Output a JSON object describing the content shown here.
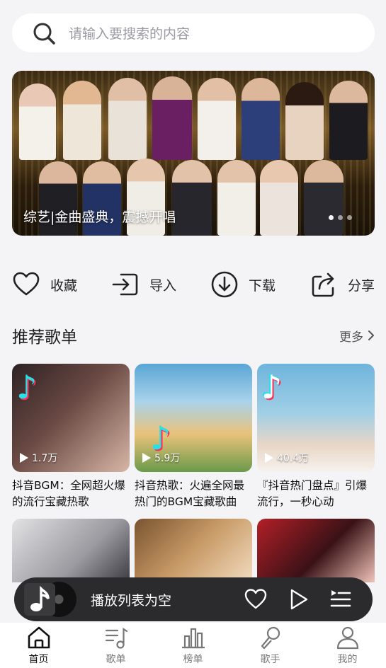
{
  "search": {
    "placeholder": "请输入要搜索的内容",
    "icon": "search-icon"
  },
  "banner": {
    "caption": "综艺|金曲盛典，震撼开唱",
    "dots": 3,
    "active_dot": 0
  },
  "actions": [
    {
      "label": "收藏",
      "icon": "heart-icon"
    },
    {
      "label": "导入",
      "icon": "import-icon"
    },
    {
      "label": "下载",
      "icon": "download-icon"
    },
    {
      "label": "分享",
      "icon": "share-icon"
    }
  ],
  "section": {
    "title": "推荐歌单",
    "more": "更多"
  },
  "playlists": [
    {
      "plays": "1.7万",
      "title": "抖音BGM：全网超火爆的流行宝藏热歌",
      "color_a": "#3b2b2e",
      "color_b": "#c9a79a"
    },
    {
      "plays": "5.9万",
      "title": "抖音热歌：火遍全网最热门的BGM宝藏歌曲",
      "color_a": "#5aa6d6",
      "color_b": "#e9c27a"
    },
    {
      "plays": "40.4万",
      "title": "『抖音热门盘点』引爆流行，一秒心动",
      "color_a": "#6fb4dc",
      "color_b": "#e8d6c6"
    }
  ],
  "more_covers": [
    {
      "color_a": "#cfcfd2",
      "color_b": "#6a6a70"
    },
    {
      "color_a": "#b98858",
      "color_b": "#f3dcc0"
    },
    {
      "color_a": "#b31f27",
      "color_b": "#f0c4b8"
    }
  ],
  "player": {
    "title": "播放列表为空"
  },
  "tabs": [
    {
      "label": "首页",
      "icon": "home-icon",
      "active": true
    },
    {
      "label": "歌单",
      "icon": "playlist-icon",
      "active": false
    },
    {
      "label": "榜单",
      "icon": "chart-icon",
      "active": false
    },
    {
      "label": "歌手",
      "icon": "microphone-icon",
      "active": false
    },
    {
      "label": "我的",
      "icon": "user-icon",
      "active": false
    }
  ]
}
